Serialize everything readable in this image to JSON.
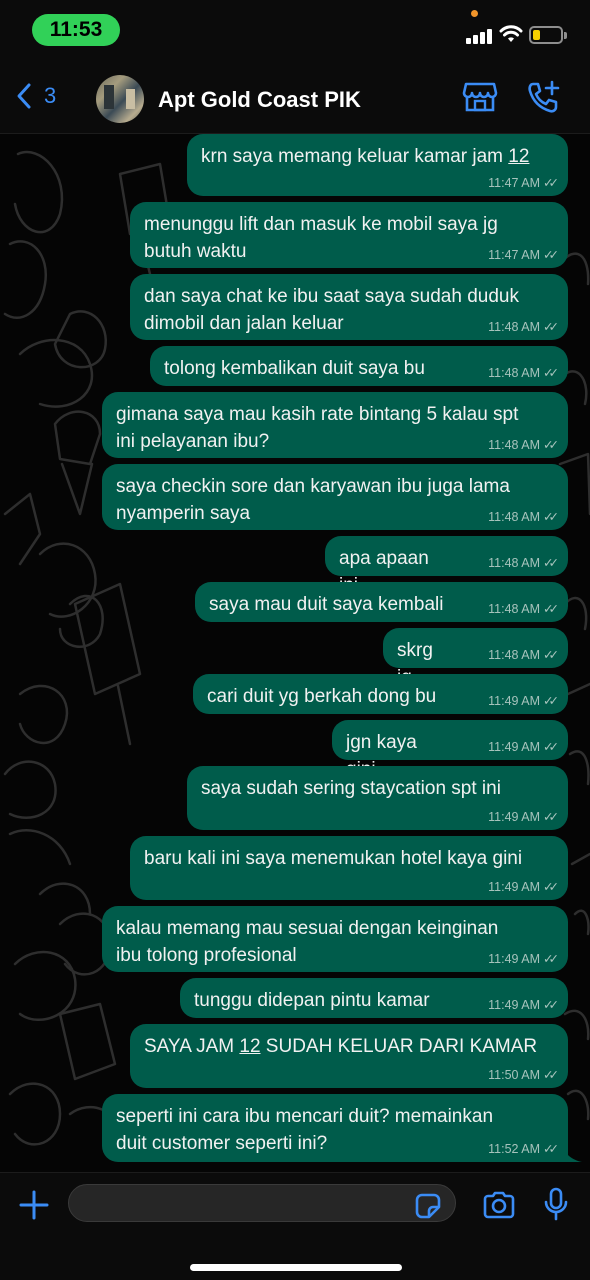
{
  "status_bar": {
    "time": "11:53"
  },
  "header": {
    "back_count": "3",
    "title": "Apt Gold Coast PIK"
  },
  "colors": {
    "accent": "#3b8cf5",
    "bubble": "#005c4b",
    "time_pill": "#31d158"
  },
  "messages": [
    {
      "text_parts": [
        "krn saya memang keluar kamar jam ",
        "12"
      ],
      "time": "11:47 AM"
    },
    {
      "text": "menunggu lift dan masuk ke mobil saya jg\nbutuh waktu",
      "time": "11:47 AM"
    },
    {
      "text": "dan saya chat ke ibu saat saya sudah duduk\ndimobil dan jalan keluar",
      "time": "11:48 AM"
    },
    {
      "text": "tolong kembalikan duit saya bu",
      "time": "11:48 AM"
    },
    {
      "text": "gimana saya mau kasih rate bintang 5 kalau spt\nini pelayanan ibu?",
      "time": "11:48 AM"
    },
    {
      "text": "saya checkin sore dan karyawan ibu juga lama\nnyamperin saya",
      "time": "11:48 AM"
    },
    {
      "text": "apa apaan ini",
      "time": "11:48 AM"
    },
    {
      "text": "saya mau duit saya kembali",
      "time": "11:48 AM"
    },
    {
      "text": "skrg jg",
      "time": "11:48 AM"
    },
    {
      "text": "cari duit yg berkah dong bu",
      "time": "11:49 AM"
    },
    {
      "text": "jgn kaya gini",
      "time": "11:49 AM"
    },
    {
      "text": "saya sudah sering staycation spt ini",
      "time": "11:49 AM"
    },
    {
      "text": "baru kali ini saya menemukan hotel kaya gini",
      "time": "11:49 AM"
    },
    {
      "text": "kalau memang mau sesuai dengan keinginan\nibu tolong profesional",
      "time": "11:49 AM"
    },
    {
      "text": "tunggu didepan pintu kamar",
      "time": "11:49 AM"
    },
    {
      "text_parts": [
        "SAYA JAM ",
        "12",
        " SUDAH KELUAR DARI KAMAR"
      ],
      "time": "11:50 AM"
    },
    {
      "text": "seperti ini cara ibu mencari duit? memainkan\nduit customer seperti ini?",
      "time": "11:52 AM"
    }
  ],
  "input": {
    "placeholder": ""
  }
}
